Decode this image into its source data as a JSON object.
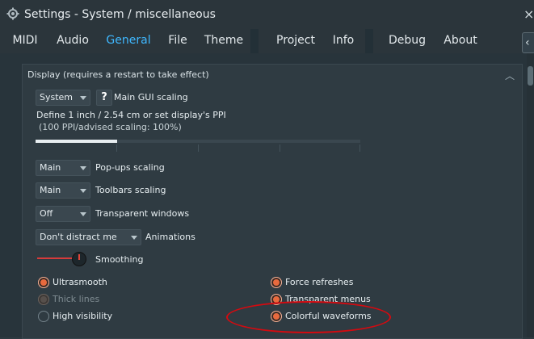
{
  "window": {
    "title": "Settings - System / miscellaneous",
    "close_glyph": "×",
    "gear_icon": "gear-icon"
  },
  "tabs": [
    {
      "label": "MIDI"
    },
    {
      "label": "Audio"
    },
    {
      "label": "General",
      "active": true
    },
    {
      "label": "File"
    },
    {
      "label": "Theme"
    },
    {
      "label": "Project"
    },
    {
      "label": "Info"
    },
    {
      "label": "Debug"
    },
    {
      "label": "About"
    }
  ],
  "tabs_extra_glyph": "‹",
  "section": {
    "title": "Display (requires a restart to take effect)",
    "collapse_glyph": "︿"
  },
  "gui_scaling": {
    "value": "System",
    "help": "?",
    "label": "Main GUI scaling"
  },
  "ppi": {
    "line1": "Define 1 inch / 2.54 cm or set display's PPI",
    "line2": "(100 PPI/advised scaling: 100%)",
    "slider_fraction": 0.25
  },
  "popups": {
    "value": "Main",
    "label": "Pop-ups scaling"
  },
  "toolbars": {
    "value": "Main",
    "label": "Toolbars scaling"
  },
  "transparent_windows": {
    "value": "Off",
    "label": "Transparent windows"
  },
  "animations": {
    "value": "Don't distract me",
    "label": "Animations"
  },
  "smoothing": {
    "label": "Smoothing"
  },
  "options_left": [
    {
      "label": "Ultrasmooth",
      "state": "on"
    },
    {
      "label": "Thick lines",
      "state": "disabled"
    },
    {
      "label": "High visibility",
      "state": "off"
    }
  ],
  "options_right": [
    {
      "label": "Force refreshes",
      "state": "on"
    },
    {
      "label": "Transparent menus",
      "state": "on"
    },
    {
      "label": "Colorful waveforms",
      "state": "on"
    }
  ],
  "colors": {
    "accent": "#3fb8ff",
    "radio_on": "#e86a3e",
    "annotation": "#d40a10"
  }
}
